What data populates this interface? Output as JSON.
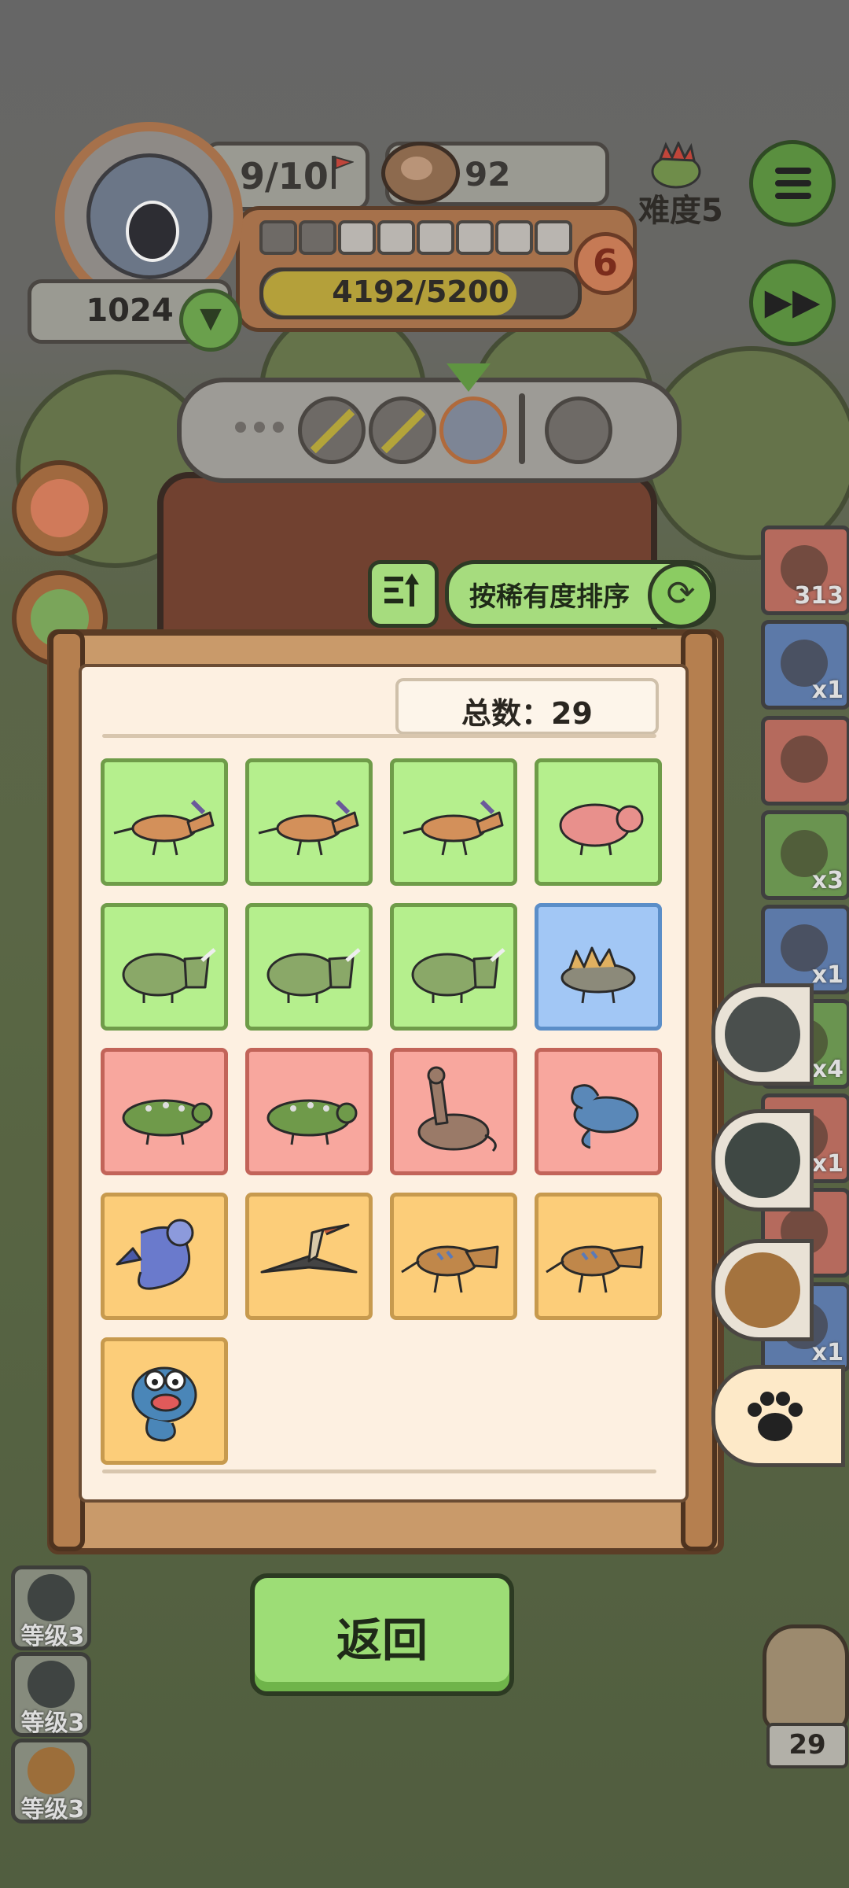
{
  "hud": {
    "unit_count": "9/10",
    "coins": "92",
    "score": "1024",
    "xp": "4192/5200",
    "xp_progress": 0.806,
    "level": "6",
    "level_segments_filled": 2,
    "level_segments_total": 8,
    "difficulty": "难度5"
  },
  "sort": {
    "label": "按稀有度排序"
  },
  "collection": {
    "total_label": "总数：29",
    "cards": [
      {
        "rarity": "green",
        "creature": "parasaurolophus"
      },
      {
        "rarity": "green",
        "creature": "parasaurolophus"
      },
      {
        "rarity": "green",
        "creature": "parasaurolophus"
      },
      {
        "rarity": "green",
        "creature": "pink-dinosaur"
      },
      {
        "rarity": "green",
        "creature": "triceratops"
      },
      {
        "rarity": "green",
        "creature": "triceratops"
      },
      {
        "rarity": "green",
        "creature": "triceratops"
      },
      {
        "rarity": "blue",
        "creature": "stegosaurus"
      },
      {
        "rarity": "red",
        "creature": "ankylosaurus"
      },
      {
        "rarity": "red",
        "creature": "ankylosaurus"
      },
      {
        "rarity": "red",
        "creature": "brachiosaurus"
      },
      {
        "rarity": "red",
        "creature": "plesiosaurus"
      },
      {
        "rarity": "gold",
        "creature": "sea-dragon"
      },
      {
        "rarity": "gold",
        "creature": "pteranodon"
      },
      {
        "rarity": "gold",
        "creature": "t-rex"
      },
      {
        "rarity": "gold",
        "creature": "t-rex"
      },
      {
        "rarity": "gold",
        "creature": "sea-monster"
      }
    ]
  },
  "side_items": [
    {
      "count": "313",
      "color": "#b56a5d"
    },
    {
      "count": "x1",
      "color": "#5c79a8"
    },
    {
      "count": "",
      "color": "#b56a5d"
    },
    {
      "count": "x3",
      "color": "#6a9450"
    },
    {
      "count": "x1",
      "color": "#5c79a8"
    },
    {
      "count": "x4",
      "color": "#6a9450"
    },
    {
      "count": "x1",
      "color": "#b56a5d"
    },
    {
      "count": "",
      "color": "#b56a5d"
    },
    {
      "count": "x1",
      "color": "#5c79a8"
    }
  ],
  "level_badges": [
    {
      "label": "等级3"
    },
    {
      "label": "等级3"
    },
    {
      "label": "等级3"
    }
  ],
  "owl_count": "29",
  "back_label": "返回",
  "colors": {
    "green_card": "#b5ef8d",
    "blue_card": "#a2c7f5",
    "red_card": "#f8a79e",
    "gold_card": "#fccd79",
    "button_green": "#9ddd76"
  }
}
